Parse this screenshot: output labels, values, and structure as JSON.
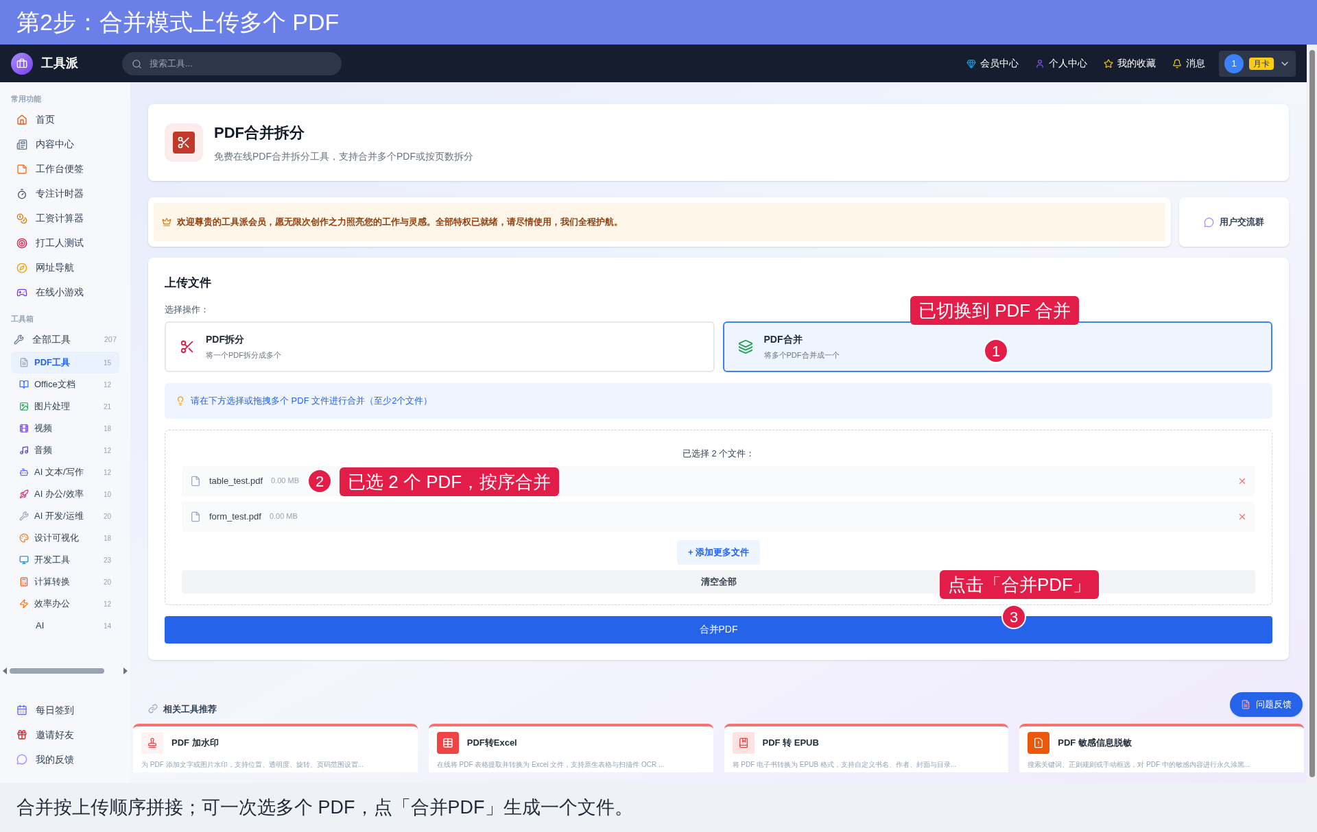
{
  "banner": {
    "title": "第2步：合并模式上传多个 PDF"
  },
  "nav": {
    "brand": "工具派",
    "search": {
      "placeholder": "搜索工具..."
    },
    "links": [
      {
        "label": "会员中心"
      },
      {
        "label": "个人中心"
      },
      {
        "label": "我的收藏"
      },
      {
        "label": "消息"
      }
    ],
    "user": {
      "avatar": "1",
      "badge": "月卡"
    }
  },
  "sidebar": {
    "sections": [
      {
        "title": "常用功能",
        "items": [
          {
            "label": "首页",
            "selected": false
          },
          {
            "label": "内容中心",
            "selected": false
          },
          {
            "label": "工作台便签",
            "selected": false
          },
          {
            "label": "专注计时器",
            "selected": false
          },
          {
            "label": "工资计算器",
            "selected": false
          },
          {
            "label": "打工人测试",
            "selected": false
          },
          {
            "label": "网址导航",
            "selected": false
          },
          {
            "label": "在线小游戏",
            "selected": false
          }
        ]
      },
      {
        "title": "工具箱",
        "items": [
          {
            "label": "全部工具",
            "count": "207",
            "selected": false,
            "children": [
              {
                "label": "PDF工具",
                "count": "15",
                "selected": true
              },
              {
                "label": "Office文档",
                "count": "12",
                "selected": false
              },
              {
                "label": "图片处理",
                "count": "21",
                "selected": false
              },
              {
                "label": "视频",
                "count": "18",
                "selected": false
              },
              {
                "label": "音频",
                "count": "12",
                "selected": false
              },
              {
                "label": "AI 文本/写作",
                "count": "12",
                "selected": false
              },
              {
                "label": "AI 办公/效率",
                "count": "10",
                "selected": false
              },
              {
                "label": "AI 开发/运维",
                "count": "20",
                "selected": false
              },
              {
                "label": "设计可视化",
                "count": "18",
                "selected": false
              },
              {
                "label": "开发工具",
                "count": "23",
                "selected": false
              },
              {
                "label": "计算转换",
                "count": "20",
                "selected": false
              },
              {
                "label": "效率办公",
                "count": "12",
                "selected": false
              },
              {
                "label": "AI",
                "count": "14",
                "selected": false
              }
            ]
          }
        ]
      }
    ],
    "footer_items": [
      {
        "label": "每日签到"
      },
      {
        "label": "邀请好友"
      },
      {
        "label": "我的反馈"
      }
    ]
  },
  "tool_header": {
    "title": "PDF合并拆分",
    "subtitle": "免费在线PDF合并拆分工具，支持合并多个PDF或按页数拆分"
  },
  "notice": {
    "text": "欢迎尊贵的工具派会员，愿无限次创作之力照亮您的工作与灵感。全部特权已就绪，请尽情使用，我们全程护航。"
  },
  "group_button": {
    "label": "用户交流群"
  },
  "upload": {
    "title": "上传文件",
    "operation_label": "选择操作：",
    "operations": [
      {
        "title": "PDF拆分",
        "desc": "将一个PDF拆分成多个",
        "selected": false
      },
      {
        "title": "PDF合并",
        "desc": "将多个PDF合并成一个",
        "selected": true
      }
    ],
    "hint": "请在下方选择或拖拽多个 PDF 文件进行合并（至少2个文件）",
    "files_heading": "已选择 2 个文件：",
    "files": [
      {
        "name": "table_test.pdf",
        "size": "0.00 MB"
      },
      {
        "name": "form_test.pdf",
        "size": "0.00 MB"
      }
    ],
    "add_button": "+ 添加更多文件",
    "clear_button": "清空全部",
    "submit_button": "合并PDF"
  },
  "related": {
    "title": "相关工具推荐",
    "cards": [
      {
        "title": "PDF 加水印",
        "desc": "为 PDF 添加文字或图片水印，支持位置、透明度、旋转、页码范围设置..."
      },
      {
        "title": "PDF转Excel",
        "desc": "在线将 PDF 表格提取并转换为 Excel 文件，支持原生表格与扫描件 OCR ..."
      },
      {
        "title": "PDF 转 EPUB",
        "desc": "将 PDF 电子书转换为 EPUB 格式，支持自定义书名、作者、封面与目录..."
      },
      {
        "title": "PDF 敏感信息脱敏",
        "desc": "搜索关键词、正则规则或手动框选，对 PDF 中的敏感内容进行永久涂黑..."
      }
    ]
  },
  "feedback_button": {
    "label": "问题反馈"
  },
  "annotations": [
    {
      "number": "1",
      "label": "已切换到 PDF 合并"
    },
    {
      "number": "2",
      "label": "已选 2 个 PDF，按序合并"
    },
    {
      "number": "3",
      "label": "点击「合并PDF」"
    }
  ],
  "caption": "合并按上传顺序拼接；可一次选多个 PDF，点「合并PDF」生成一个文件。"
}
